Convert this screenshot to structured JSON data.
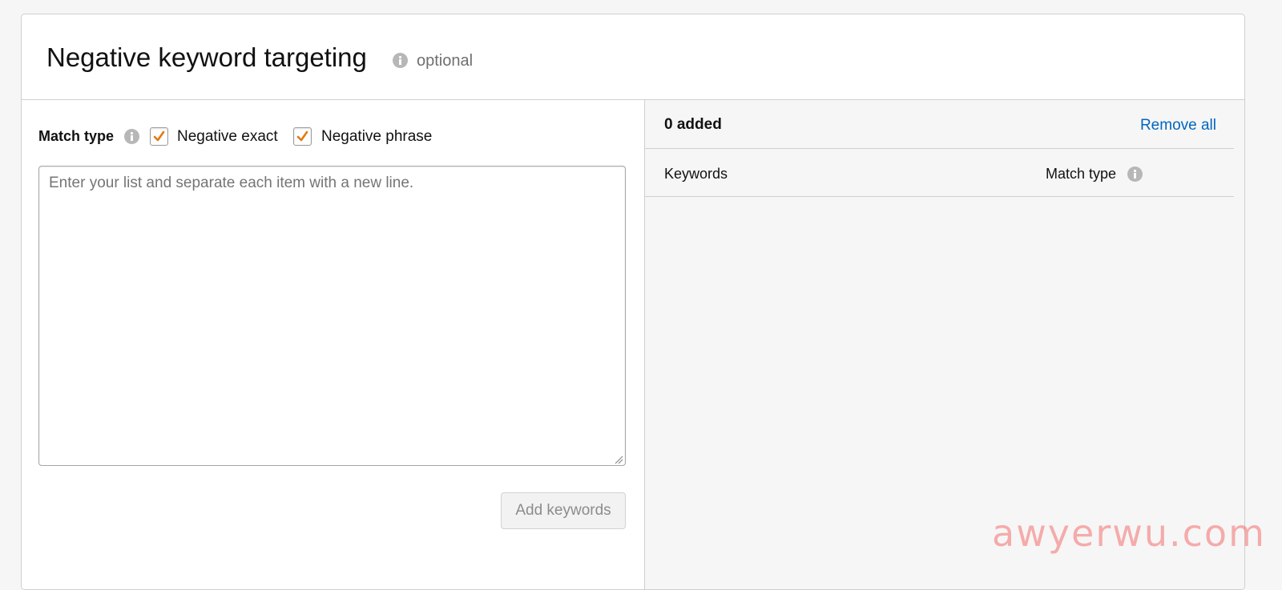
{
  "section": {
    "title": "Negative keyword targeting",
    "optional_label": "optional",
    "info_icon": "info-icon"
  },
  "left_pane": {
    "match_type_label": "Match type",
    "match_types": [
      {
        "label": "Negative exact",
        "checked": true
      },
      {
        "label": "Negative phrase",
        "checked": true
      }
    ],
    "textarea": {
      "value": "",
      "placeholder": "Enter your list and separate each item with a new line."
    },
    "add_button_label": "Add keywords",
    "add_button_enabled": false
  },
  "right_pane": {
    "added_count": "0 added",
    "remove_all_label": "Remove all",
    "columns": [
      "Keywords",
      "Match type"
    ],
    "rows": []
  },
  "colors": {
    "accent_checkmark": "#e47911",
    "link": "#0066c0",
    "right_pane_background": "#f6f6f6"
  },
  "watermark": "awyerwu.com"
}
